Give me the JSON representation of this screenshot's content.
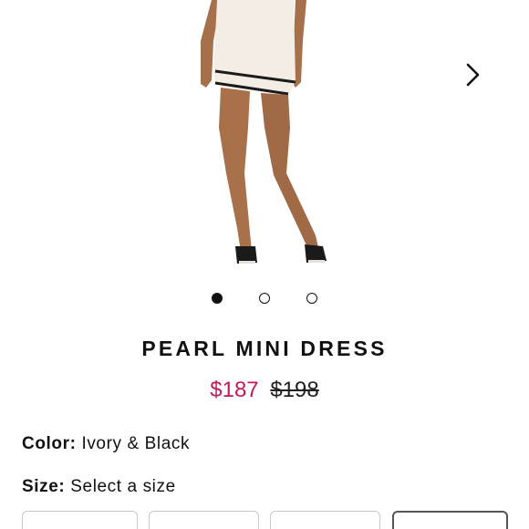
{
  "gallery": {
    "image_alt": "Model wearing ivory knit mini dress with black trim",
    "next_icon": "chevron-right-icon",
    "dots": [
      {
        "active": true
      },
      {
        "active": false
      },
      {
        "active": false
      }
    ]
  },
  "product": {
    "title": "PEARL MINI DRESS",
    "price_sale": "$187",
    "price_original": "$198"
  },
  "options": {
    "color_label": "Color:",
    "color_value": "Ivory & Black",
    "size_label": "Size:",
    "size_value": "Select a size",
    "size_buttons": [
      "",
      "",
      "",
      ""
    ]
  },
  "colors": {
    "sale": "#c2185b",
    "text": "#111111",
    "border": "#c8c8c8"
  }
}
